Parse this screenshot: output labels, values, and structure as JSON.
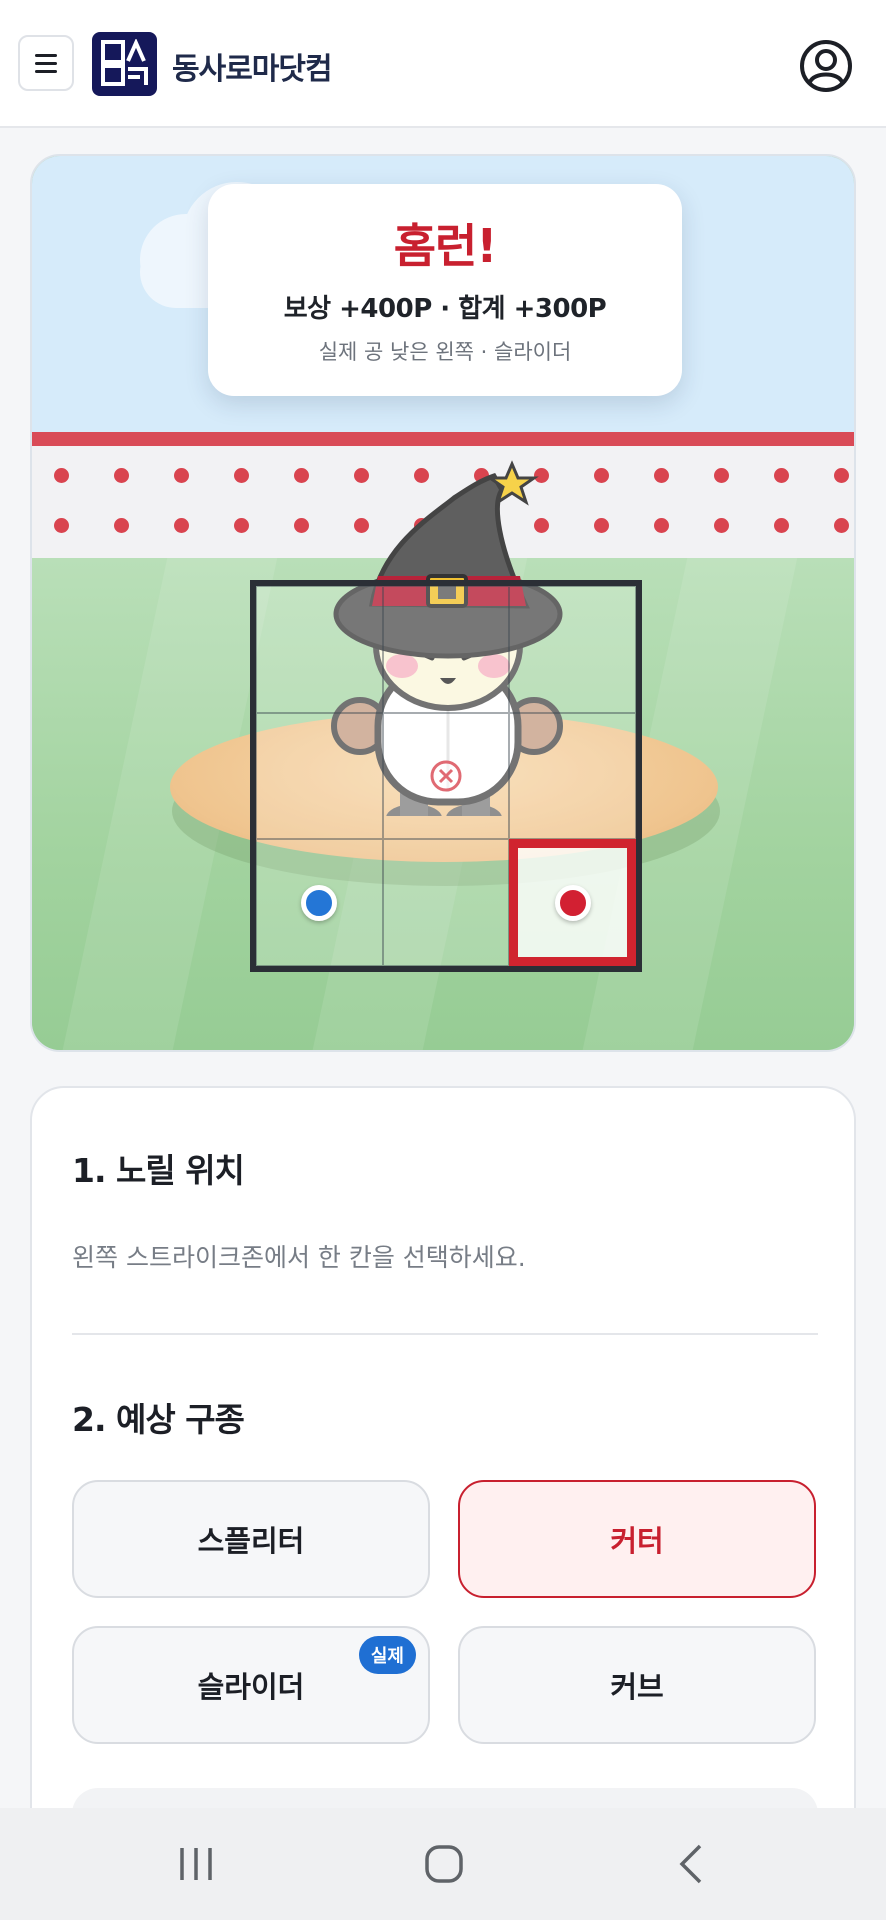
{
  "header": {
    "brand": "동사로마닷컴",
    "logo_text": "동사로마",
    "menu_icon": "hamburger-icon",
    "user_icon": "user-circle-icon"
  },
  "result": {
    "title": "홈런!",
    "reward": "보상 +400P · 합계 +300P",
    "detail": "실제 공 낮은 왼쪽 · 슬라이더"
  },
  "strike_zone": {
    "selected_cell": "bottom-right",
    "aim_cell": "bottom-left",
    "target_marker": "center"
  },
  "section1": {
    "title": "1. 노릴 위치",
    "description": "왼쪽 스트라이크존에서 한 칸을 선택하세요."
  },
  "section2": {
    "title": "2. 예상 구종",
    "options": [
      {
        "label": "스플리터",
        "active": false
      },
      {
        "label": "커터",
        "active": true
      },
      {
        "label": "슬라이더",
        "active": false,
        "badge": "실제"
      },
      {
        "label": "커브",
        "active": false
      }
    ]
  },
  "colors": {
    "accent_red": "#c8202f",
    "accent_blue": "#1f6fd3",
    "brand_navy": "#15185a"
  },
  "navbar": {
    "items": [
      "recent-apps-icon",
      "home-icon",
      "back-icon"
    ]
  }
}
